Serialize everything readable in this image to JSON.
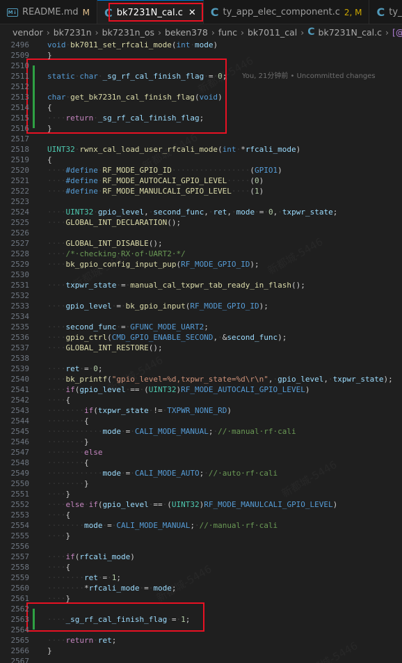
{
  "tabs": [
    {
      "label": "README.md",
      "status": "M",
      "icon": "markdown-icon",
      "active": false
    },
    {
      "label": "bk7231N_cal.c",
      "status": "",
      "icon": "c-file-icon",
      "active": true
    },
    {
      "label": "ty_app_elec_component.c",
      "status": "2, M",
      "icon": "c-file-icon",
      "active": false
    },
    {
      "label": "ty_",
      "status": "",
      "icon": "c-file-icon",
      "active": false
    }
  ],
  "breadcrumb": [
    "vendor",
    "bk7231n",
    "bk7231n_os",
    "beken378",
    "func",
    "bk7011_cal",
    "bk7231N_cal.c",
    "_sg_"
  ],
  "blame": "You, 21分钟前 • Uncommitted changes",
  "watermark": "新都城-5446",
  "lines": [
    {
      "n": "2496",
      "code": "void bk7011_set_rfcali_mode(int mode)"
    },
    {
      "n": "2509",
      "code": "}"
    },
    {
      "n": "2510",
      "code": ""
    },
    {
      "n": "2511",
      "code": "static char _sg_rf_cal_finish_flag = 0;"
    },
    {
      "n": "2512",
      "code": ""
    },
    {
      "n": "2513",
      "code": "char get_bk7231n_cal_finish_flag(void)"
    },
    {
      "n": "2514",
      "code": "{"
    },
    {
      "n": "2515",
      "code": "    return _sg_rf_cal_finish_flag;"
    },
    {
      "n": "2516",
      "code": "}"
    },
    {
      "n": "2517",
      "code": ""
    },
    {
      "n": "2518",
      "code": "UINT32 rwnx_cal_load_user_rfcali_mode(int *rfcali_mode)"
    },
    {
      "n": "2519",
      "code": "{"
    },
    {
      "n": "2520",
      "code": "    #define RF_MODE_GPIO_ID                 (GPIO1)"
    },
    {
      "n": "2521",
      "code": "    #define RF_MODE_AUTOCALI_GPIO_LEVEL     (0)"
    },
    {
      "n": "2522",
      "code": "    #define RF_MODE_MANULCALI_GPIO_LEVEL    (1)"
    },
    {
      "n": "2523",
      "code": ""
    },
    {
      "n": "2524",
      "code": "    UINT32 gpio_level, second_func, ret, mode = 0, txpwr_state;"
    },
    {
      "n": "2525",
      "code": "    GLOBAL_INT_DECLARATION();"
    },
    {
      "n": "2526",
      "code": ""
    },
    {
      "n": "2527",
      "code": "    GLOBAL_INT_DISABLE();"
    },
    {
      "n": "2528",
      "code": "    /* checking RX of UART2 */"
    },
    {
      "n": "2529",
      "code": "    bk_gpio_config_input_pup(RF_MODE_GPIO_ID);"
    },
    {
      "n": "2530",
      "code": ""
    },
    {
      "n": "2531",
      "code": "    txpwr_state = manual_cal_txpwr_tab_ready_in_flash();"
    },
    {
      "n": "2532",
      "code": ""
    },
    {
      "n": "2533",
      "code": "    gpio_level = bk_gpio_input(RF_MODE_GPIO_ID);"
    },
    {
      "n": "2534",
      "code": ""
    },
    {
      "n": "2535",
      "code": "    second_func = GFUNC_MODE_UART2;"
    },
    {
      "n": "2536",
      "code": "    gpio_ctrl(CMD_GPIO_ENABLE_SECOND, &second_func);"
    },
    {
      "n": "2537",
      "code": "    GLOBAL_INT_RESTORE();"
    },
    {
      "n": "2538",
      "code": ""
    },
    {
      "n": "2539",
      "code": "    ret = 0;"
    },
    {
      "n": "2540",
      "code": "    bk_printf(\"gpio_level=%d,txpwr_state=%d\\r\\n\", gpio_level, txpwr_state);"
    },
    {
      "n": "2541",
      "code": "    if(gpio_level == (UINT32)RF_MODE_AUTOCALI_GPIO_LEVEL)"
    },
    {
      "n": "2542",
      "code": "    {"
    },
    {
      "n": "2543",
      "code": "        if(txpwr_state != TXPWR_NONE_RD)"
    },
    {
      "n": "2544",
      "code": "        {"
    },
    {
      "n": "2545",
      "code": "            mode = CALI_MODE_MANUAL; // manual rf cali"
    },
    {
      "n": "2546",
      "code": "        }"
    },
    {
      "n": "2547",
      "code": "        else"
    },
    {
      "n": "2548",
      "code": "        {"
    },
    {
      "n": "2549",
      "code": "            mode = CALI_MODE_AUTO; // auto rf cali"
    },
    {
      "n": "2550",
      "code": "        }"
    },
    {
      "n": "2551",
      "code": "    }"
    },
    {
      "n": "2552",
      "code": "    else if(gpio_level == (UINT32)RF_MODE_MANULCALI_GPIO_LEVEL)"
    },
    {
      "n": "2553",
      "code": "    {"
    },
    {
      "n": "2554",
      "code": "        mode = CALI_MODE_MANUAL; // manual rf cali"
    },
    {
      "n": "2555",
      "code": "    }"
    },
    {
      "n": "2556",
      "code": ""
    },
    {
      "n": "2557",
      "code": "    if(rfcali_mode)"
    },
    {
      "n": "2558",
      "code": "    {"
    },
    {
      "n": "2559",
      "code": "        ret = 1;"
    },
    {
      "n": "2560",
      "code": "        *rfcali_mode = mode;"
    },
    {
      "n": "2561",
      "code": "    }"
    },
    {
      "n": "2562",
      "code": ""
    },
    {
      "n": "2563",
      "code": "    _sg_rf_cal_finish_flag = 1;"
    },
    {
      "n": "2564",
      "code": ""
    },
    {
      "n": "2565",
      "code": "    return ret;"
    },
    {
      "n": "2566",
      "code": "}"
    },
    {
      "n": "2567",
      "code": ""
    }
  ]
}
